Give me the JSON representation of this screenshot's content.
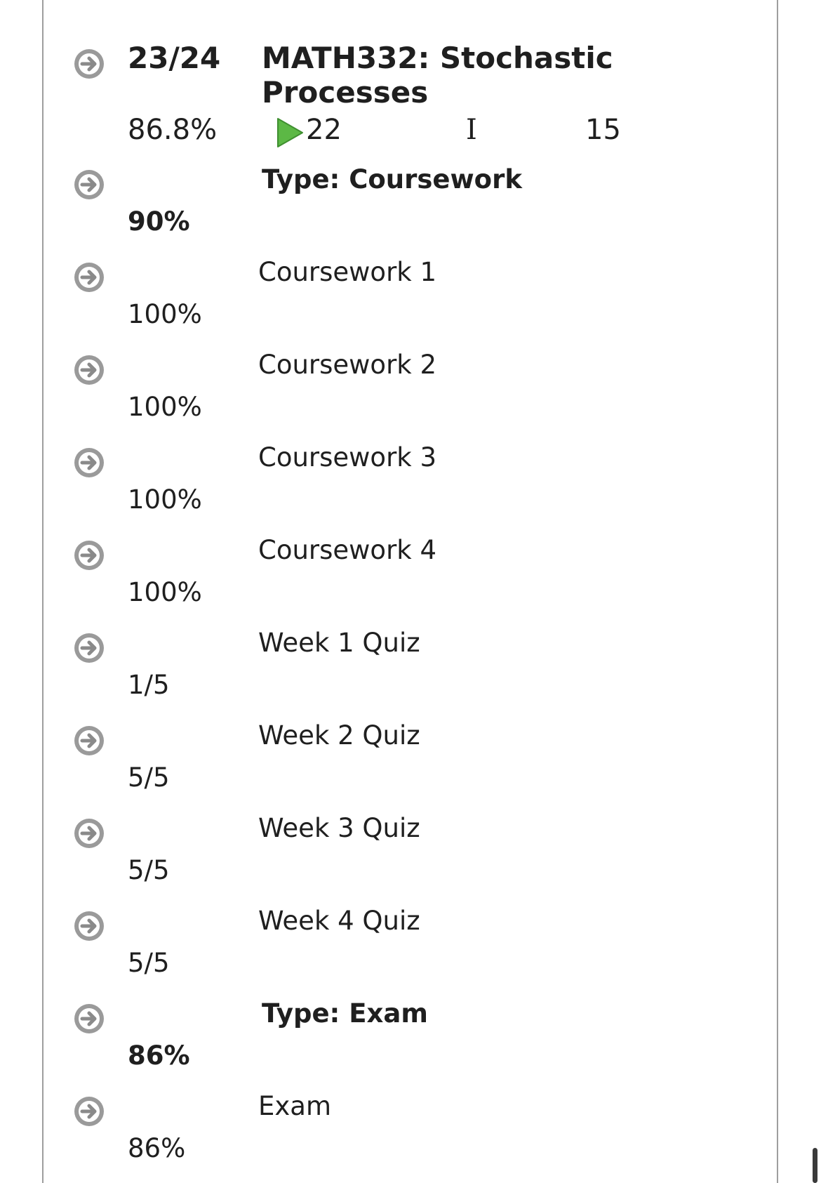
{
  "course": {
    "rank": "23/24",
    "title": "MATH332: Stochastic Processes",
    "percent": "86.8%",
    "count_a": "22",
    "status_letter": "I",
    "count_b": "15"
  },
  "rows": [
    {
      "name": "Type: Coursework",
      "score": "90%"
    },
    {
      "name": "Coursework 1",
      "score": "100%"
    },
    {
      "name": "Coursework 2",
      "score": "100%"
    },
    {
      "name": "Coursework 3",
      "score": "100%"
    },
    {
      "name": "Coursework 4",
      "score": "100%"
    },
    {
      "name": "Week 1 Quiz",
      "score": "1/5"
    },
    {
      "name": "Week 2 Quiz",
      "score": "5/5"
    },
    {
      "name": "Week 3 Quiz",
      "score": "5/5"
    },
    {
      "name": "Week 4 Quiz",
      "score": "5/5"
    },
    {
      "name": "Type: Exam",
      "score": "86%"
    },
    {
      "name": "Exam",
      "score": "86%"
    }
  ],
  "colors": {
    "arrow_icon": "#9a9a9a",
    "play_icon": "#5cb845",
    "border": "#9e9e9e"
  }
}
